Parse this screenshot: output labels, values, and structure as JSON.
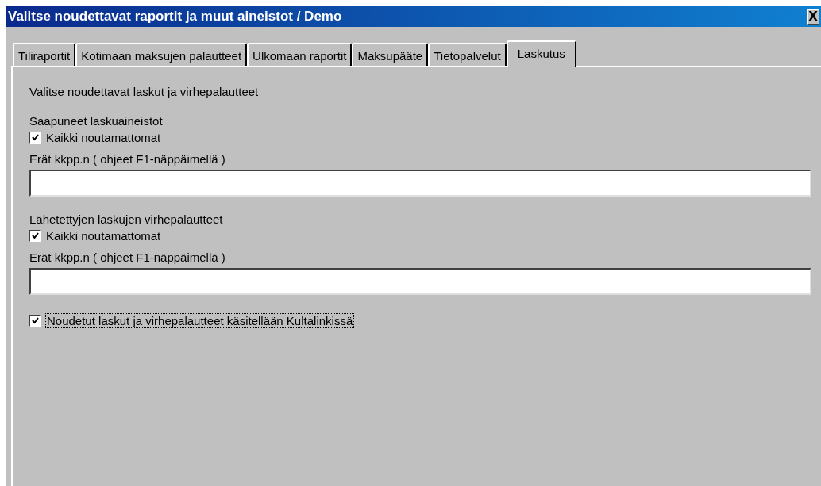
{
  "window": {
    "title": "Valitse noudettavat raportit ja muut aineistot / Demo",
    "close_button": "X"
  },
  "tabs": [
    {
      "label": "Tiliraportit",
      "selected": false
    },
    {
      "label": "Kotimaan maksujen palautteet",
      "selected": false
    },
    {
      "label": "Ulkomaan raportit",
      "selected": false
    },
    {
      "label": "Maksupääte",
      "selected": false
    },
    {
      "label": "Tietopalvelut",
      "selected": false
    },
    {
      "label": "Laskutus",
      "selected": true
    }
  ],
  "intro": "Valitse noudettavat laskut ja virhepalautteet",
  "sections": [
    {
      "heading": "Saapuneet laskuaineistot",
      "checkbox": {
        "label": "Kaikki noutamattomat",
        "checked": true
      },
      "field_label": "Erät kkpp.n ( ohjeet F1-näppäimellä )"
    },
    {
      "heading": "Lähetettyjen laskujen virhepalautteet",
      "checkbox": {
        "label": "Kaikki noutamattomat",
        "checked": true
      },
      "field_label": "Erät kkpp.n ( ohjeet F1-näppäimellä )"
    }
  ],
  "final_checkbox": {
    "label": "Noudetut laskut ja virhepalautteet käsitellään Kultalinkissä",
    "checked": true,
    "focused": true
  }
}
